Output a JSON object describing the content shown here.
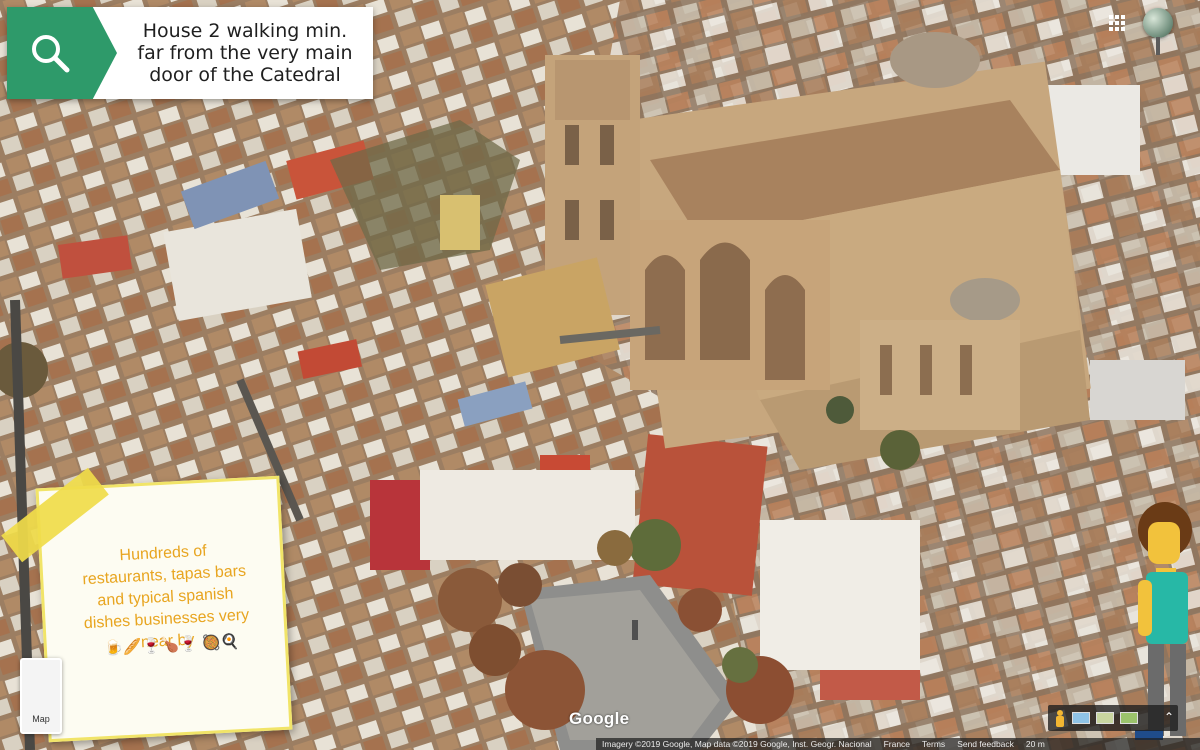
{
  "search_card": {
    "text": "House 2 walking min.\nfar from the very main\ndoor of the Catedral",
    "icon": "search-icon",
    "accent": "#2e9a6a"
  },
  "note": {
    "text": "Hundreds of\nrestaurants, tapas bars\nand typical spanish\ndishes businesses very\nnear by",
    "emoji_row": "🍺🥖🍷🍗🍷\n🥘🍳",
    "text_color": "#e8a520",
    "border_color": "#f1e468"
  },
  "map_thumb": {
    "label": "Map"
  },
  "google_logo": "Google",
  "attribution": {
    "imagery": "Imagery ©2019 Google, Map data ©2019 Google, Inst. Geogr. Nacional",
    "country": "France",
    "terms": "Terms",
    "feedback": "Send feedback",
    "scale": "20 m"
  },
  "pegman_control": {
    "icon": "pegman-icon",
    "layers": [
      "layer-blue",
      "layer-satellite",
      "layer-green"
    ]
  },
  "scene_labels": {
    "building": "Cathedral of Granada",
    "plaza": "plaza with trees"
  }
}
